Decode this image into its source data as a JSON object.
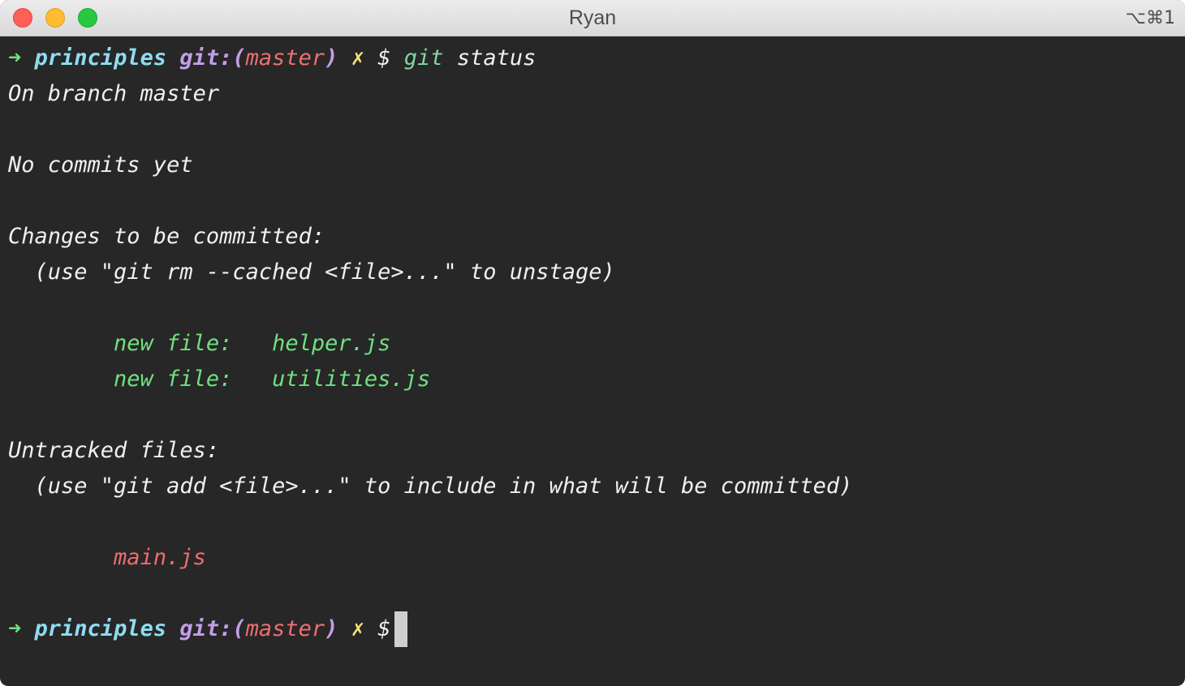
{
  "window": {
    "title": "Ryan",
    "shortcut": "⌥⌘1"
  },
  "prompt": {
    "arrow": "➜",
    "dir": "principles",
    "git_label": "git:(",
    "branch": "master",
    "close_paren": ")",
    "dirty": "✗",
    "dollar": "$"
  },
  "command": {
    "name": "git",
    "args": "status"
  },
  "output": {
    "branch_line": "On branch master",
    "no_commits": "No commits yet",
    "changes_header": "Changes to be committed:",
    "changes_hint": "  (use \"git rm --cached <file>...\" to unstage)",
    "staged": [
      {
        "label": "        new file:   ",
        "file": "helper.js"
      },
      {
        "label": "        new file:   ",
        "file": "utilities.js"
      }
    ],
    "untracked_header": "Untracked files:",
    "untracked_hint": "  (use \"git add <file>...\" to include in what will be committed)",
    "untracked_indent": "        ",
    "untracked": [
      "main.js"
    ]
  },
  "colors": {
    "background": "#272727",
    "prompt_arrow": "#6fe07f",
    "dir": "#8fdcf0",
    "git_label": "#c49ee8",
    "branch": "#ed6f6f",
    "staged": "#6fe07f",
    "untracked": "#ed6f6f"
  }
}
